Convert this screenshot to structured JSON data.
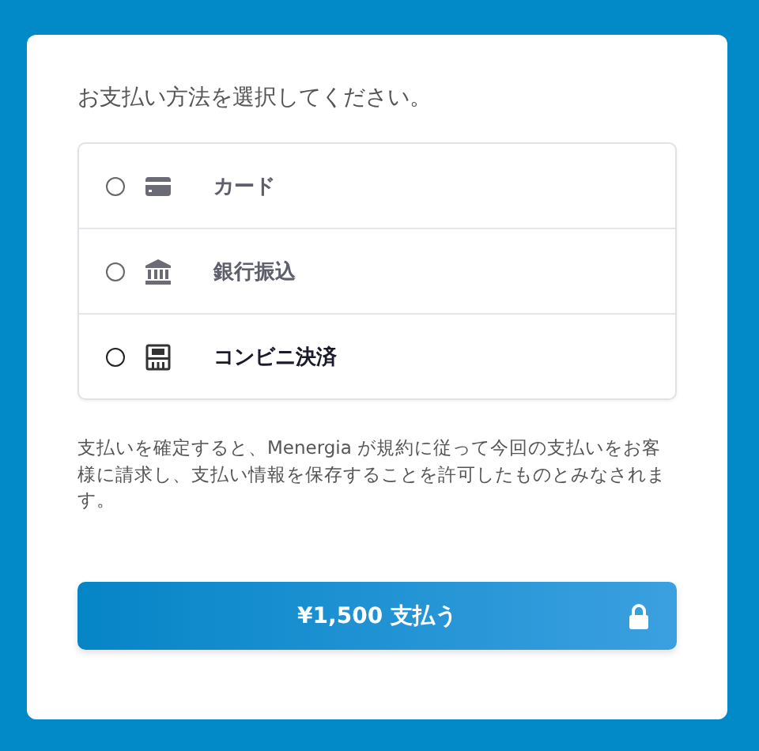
{
  "heading": "お支払い方法を選択してください。",
  "methods": [
    {
      "kind": "card",
      "label": "カード",
      "selected": false,
      "highlighted": false
    },
    {
      "kind": "bank",
      "label": "銀行振込",
      "selected": false,
      "highlighted": false
    },
    {
      "kind": "store",
      "label": "コンビニ決済",
      "selected": false,
      "highlighted": true
    }
  ],
  "notice": "支払いを確定すると、Menergia が規約に従って今回の支払いをお客様に請求し、支払い情報を保存することを許可したものとみなされます。",
  "pay_button": {
    "label": "¥1,500 支払う"
  }
}
